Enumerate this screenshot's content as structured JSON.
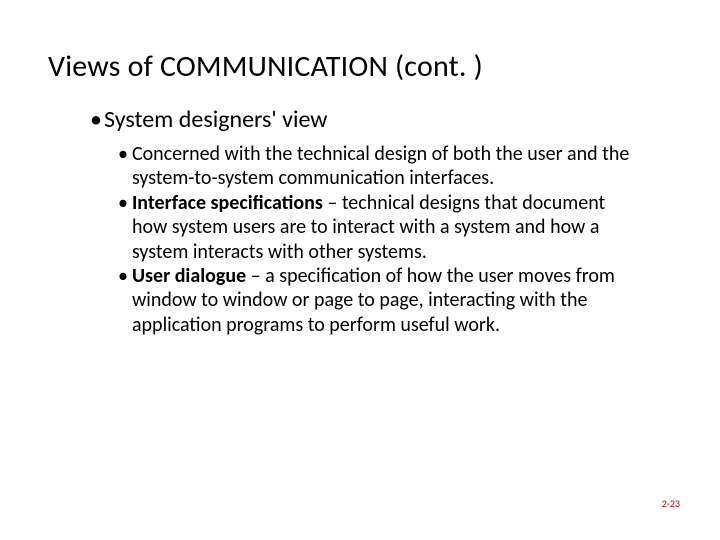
{
  "title": "Views of COMMUNICATION (cont. )",
  "level1": {
    "bullet": "•",
    "text": "System designers' view"
  },
  "bullets": {
    "b1": {
      "mark": "•",
      "text": "Concerned with the technical design of both the user and the system-to-system communication interfaces."
    },
    "b2": {
      "mark": "•",
      "bold": "Interface specifications",
      "rest": " – technical designs that document how system users are to interact with a system and how a system interacts with other systems."
    },
    "b3": {
      "mark": "•",
      "bold": "User dialogue",
      "rest": " – a specification of how the user moves from window to window or page to page, interacting with the application programs to perform useful work."
    }
  },
  "page_number": "2-23"
}
